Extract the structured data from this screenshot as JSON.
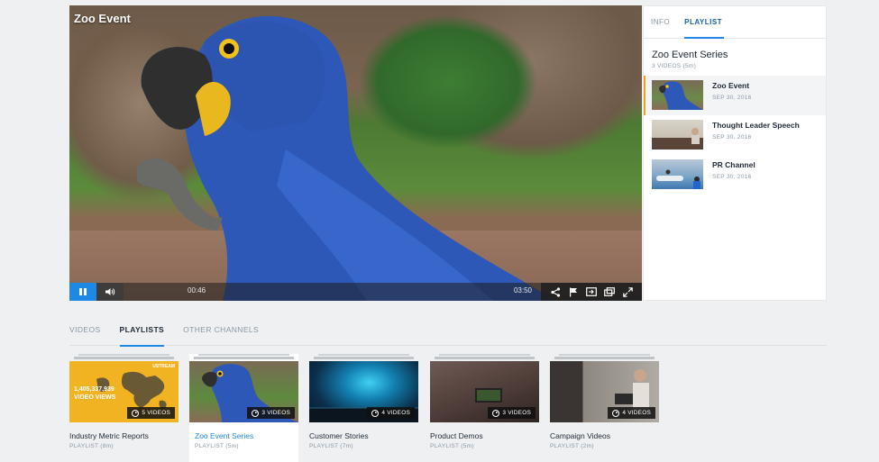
{
  "player": {
    "title": "Zoo Event",
    "time_current": "00:46",
    "time_total": "03:50",
    "progress": 0.0
  },
  "panel": {
    "tabs": [
      {
        "label": "INFO",
        "active": false
      },
      {
        "label": "PLAYLIST",
        "active": true
      }
    ],
    "series_title": "Zoo Event Series",
    "series_sub": "3 VIDEOS (5m)",
    "items": [
      {
        "name": "Zoo Event",
        "date": "SEP 30, 2016"
      },
      {
        "name": "Thought Leader Speech",
        "date": "SEP 30, 2016"
      },
      {
        "name": "PR Channel",
        "date": "SEP 30, 2016"
      }
    ]
  },
  "channel_tabs": [
    {
      "label": "VIDEOS"
    },
    {
      "label": "PLAYLISTS"
    },
    {
      "label": "OTHER CHANNELS"
    }
  ],
  "cards": [
    {
      "name": "Industry Metric Reports",
      "sub": "PLAYLIST (8m)",
      "badge": "5 VIDEOS",
      "thumb_logo": "USTREAM",
      "thumb_number": "1,405,337,939",
      "thumb_caption": "VIDEO VIEWS"
    },
    {
      "name": "Zoo Event Series",
      "sub": "PLAYLIST (5m)",
      "badge": "3 VIDEOS"
    },
    {
      "name": "Customer Stories",
      "sub": "PLAYLIST (7m)",
      "badge": "4 VIDEOS"
    },
    {
      "name": "Product Demos",
      "sub": "PLAYLIST (5m)",
      "badge": "3 VIDEOS"
    },
    {
      "name": "Campaign Videos",
      "sub": "PLAYLIST (2m)",
      "badge": "4 VIDEOS"
    }
  ],
  "colors": {
    "accent": "#1e88e5",
    "active_marker": "#f3a01c"
  }
}
